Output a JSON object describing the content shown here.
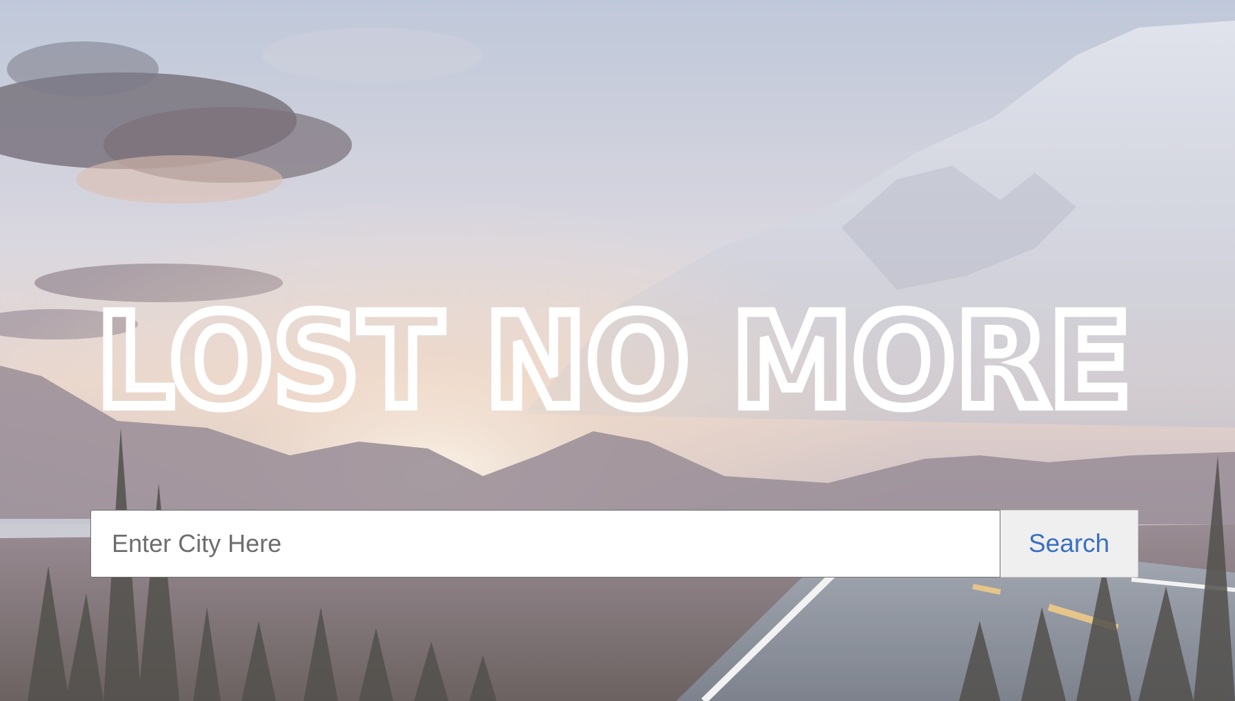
{
  "hero": {
    "title": "LOST NO MORE"
  },
  "search": {
    "placeholder": "Enter City Here",
    "button_label": "Search"
  },
  "colors": {
    "title": "#ffffff",
    "button_text": "#3a6fc4",
    "button_bg": "#efefef",
    "input_bg": "#ffffff"
  }
}
